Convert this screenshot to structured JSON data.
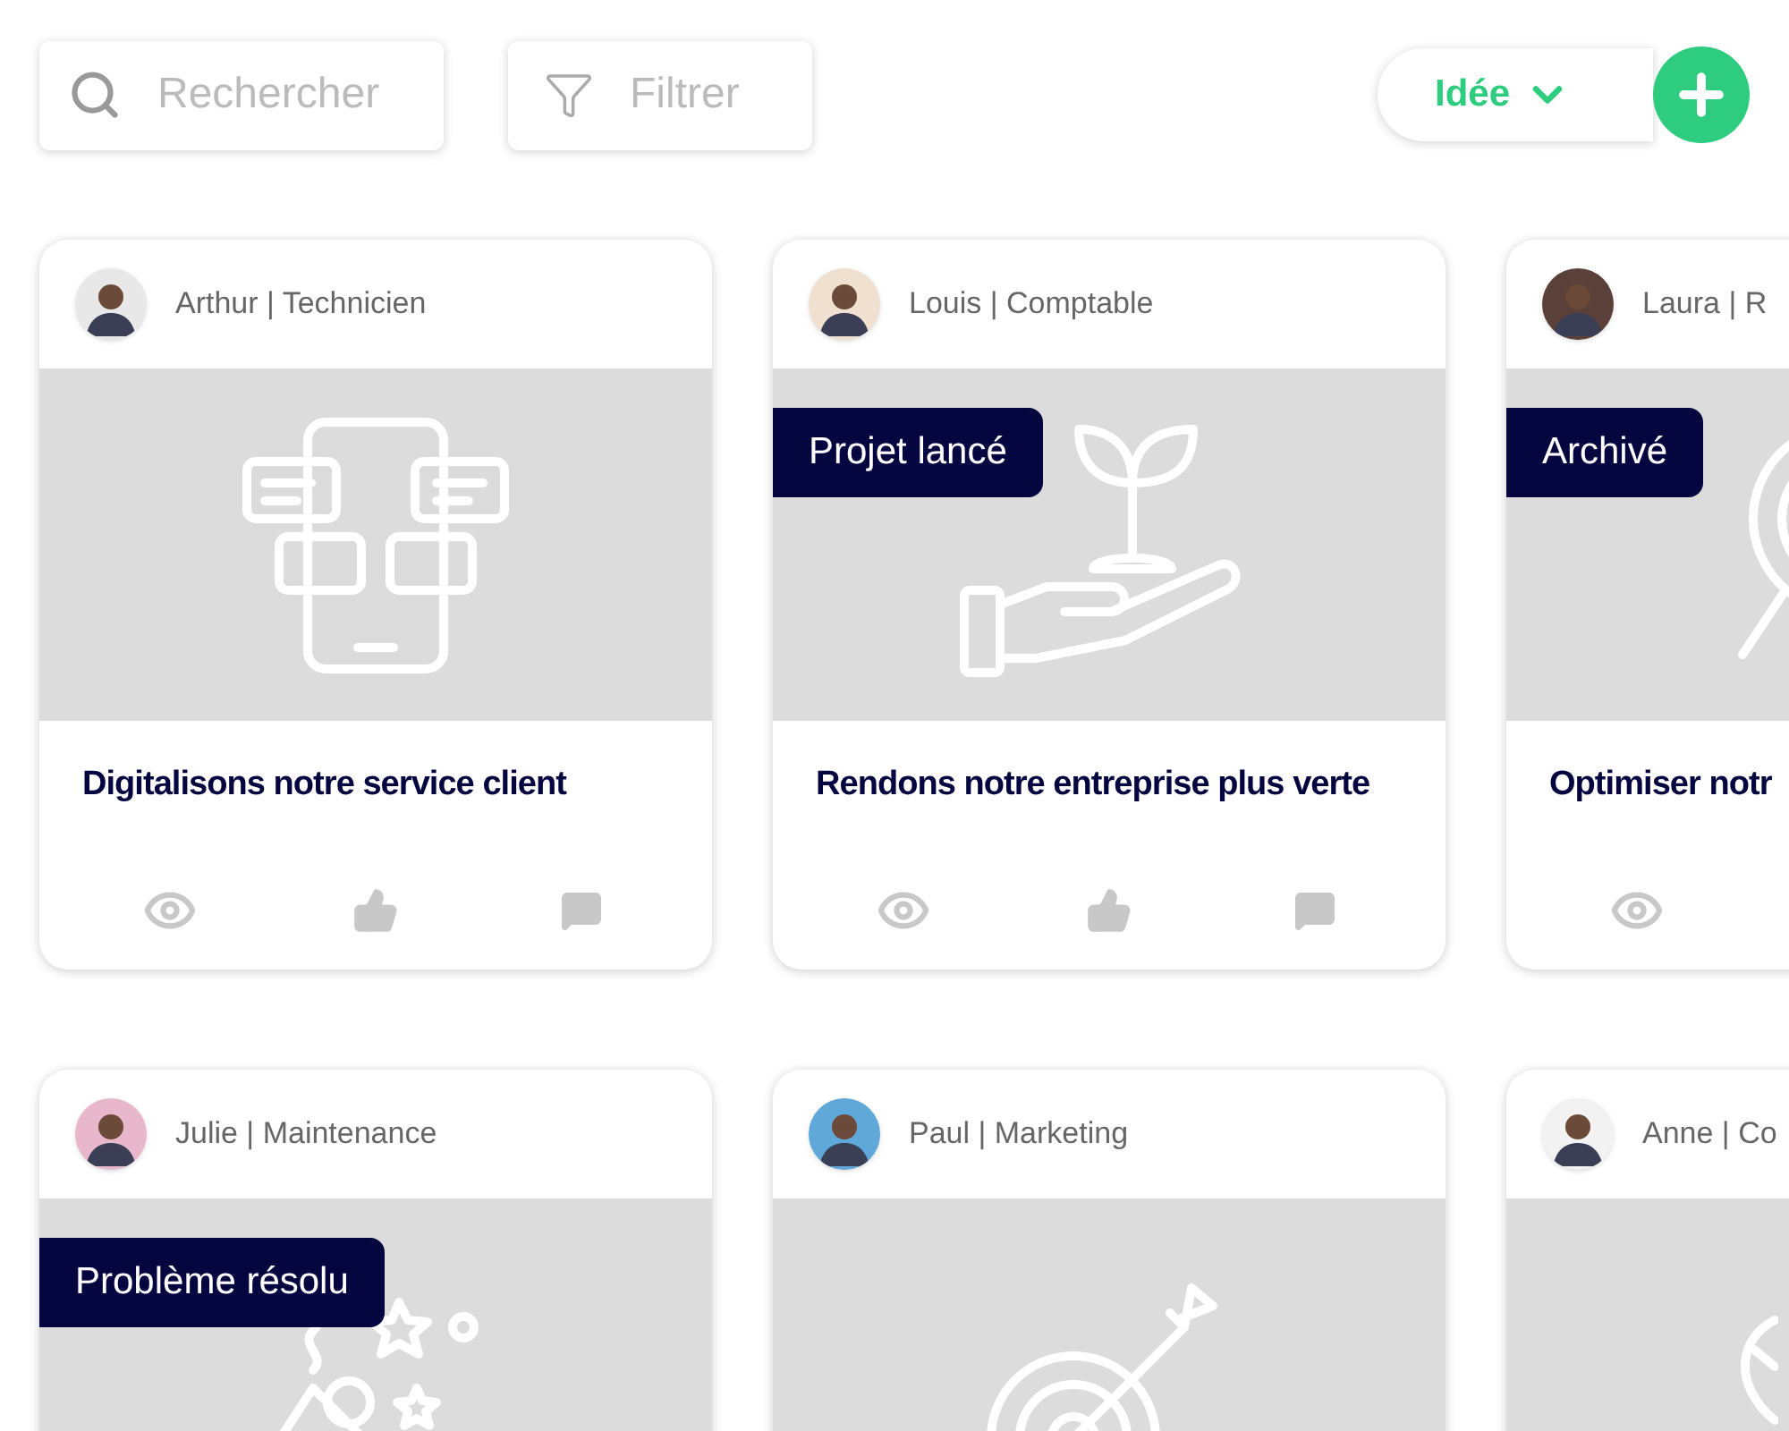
{
  "toolbar": {
    "search": {
      "placeholder": "Rechercher"
    },
    "filter": {
      "label": "Filtrer"
    },
    "type_select": {
      "value": "Idée"
    }
  },
  "cards": [
    {
      "author": "Arthur | Technicien",
      "title": "Digitalisons notre service client",
      "actions": [
        {
          "kind": "views"
        },
        {
          "kind": "likes"
        },
        {
          "kind": "comments"
        }
      ]
    },
    {
      "author": "Louis | Comptable",
      "status": "Projet lancé",
      "title": "Rendons notre entreprise plus verte",
      "actions": [
        {
          "kind": "views"
        },
        {
          "kind": "likes"
        },
        {
          "kind": "comments"
        }
      ]
    },
    {
      "author": "Laura | R",
      "status": "Archivé",
      "title": "Optimiser notr",
      "actions": [
        {
          "kind": "views"
        }
      ]
    },
    {
      "author": "Julie | Maintenance",
      "status": "Problème résolu"
    },
    {
      "author": "Paul | Marketing"
    },
    {
      "author": "Anne | Co"
    }
  ]
}
